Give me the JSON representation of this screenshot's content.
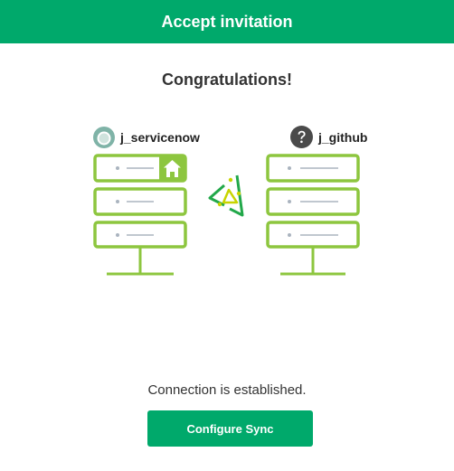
{
  "header": {
    "title": "Accept invitation"
  },
  "main": {
    "heading": "Congratulations!",
    "left_user": {
      "name": "j_servicenow",
      "icon": "user-avatar-icon"
    },
    "right_user": {
      "name": "j_github",
      "icon": "question-mark-icon"
    },
    "left_server_icons": [
      "home-icon"
    ],
    "connection_icon": "connection-exchange-icon",
    "status_text": "Connection is established.",
    "configure_button_label": "Configure Sync"
  },
  "colors": {
    "brand_green": "#00a96b",
    "server_green": "#8dc63f",
    "arrow_green": "#22a84a",
    "arrow_yellow": "#c8d400",
    "avatar_teal": "#7fb3a7",
    "question_dark": "#4a4a4a"
  }
}
